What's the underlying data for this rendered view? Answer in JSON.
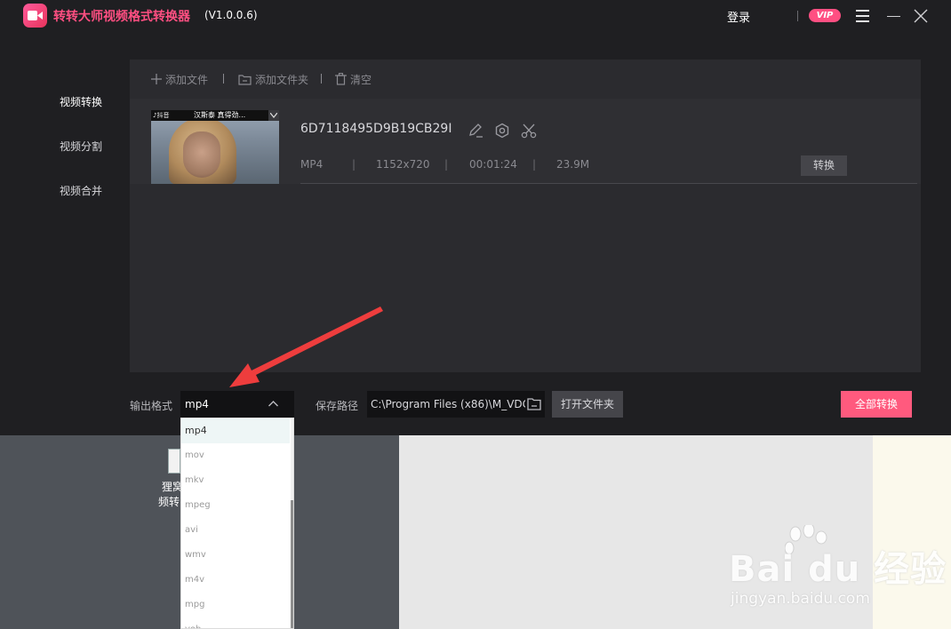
{
  "app": {
    "title": "转转大师视频格式转换器",
    "version": "(V1.0.0.6)",
    "login_label": "登录",
    "vip_label": "VIP"
  },
  "sidebar": {
    "items": [
      {
        "label": "视频转换"
      },
      {
        "label": "视频分割"
      },
      {
        "label": "视频合并"
      }
    ]
  },
  "toolbar": {
    "add_file": "添加文件",
    "add_folder": "添加文件夹",
    "clear": "清空"
  },
  "file": {
    "name": "6D7118495D9B19CB29I",
    "format": "MP4",
    "resolution": "1152x720",
    "duration": "00:01:24",
    "size": "23.9M",
    "convert_label": "转换",
    "thumb_caption": "汉斯泰 真得劲..."
  },
  "bottom": {
    "format_label": "输出格式",
    "format_value": "mp4",
    "path_label": "保存路径",
    "path_value": "C:\\Program Files (x86)\\M_VDC",
    "open_folder_label": "打开文件夹",
    "convert_all_label": "全部转换"
  },
  "dropdown": {
    "options": [
      "mp4",
      "mov",
      "mkv",
      "mpeg",
      "avi",
      "wmv",
      "m4v",
      "mpg",
      "vob"
    ]
  },
  "desktop": {
    "icon_label_line1": "狸窝",
    "icon_label_line2": "频转"
  },
  "watermark": {
    "brand": "Bai du 经验",
    "url": "jingyan.baidu.com"
  },
  "colors": {
    "accent": "#ff5a7e",
    "title_pink": "#ff4f82",
    "background": "#1f1f22",
    "panel": "#2b2b2f",
    "arrow": "#ee3d3d"
  }
}
